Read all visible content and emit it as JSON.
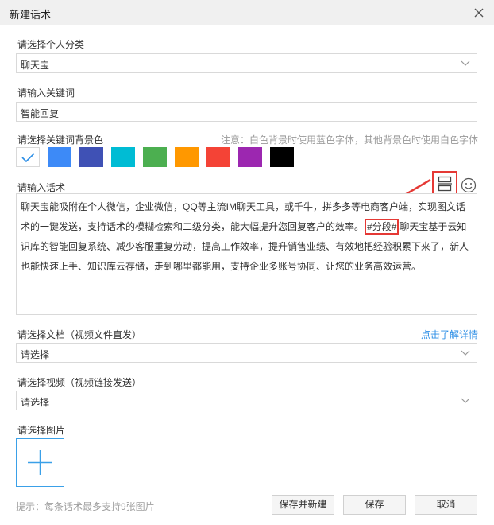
{
  "window": {
    "title": "新建话术"
  },
  "category": {
    "label": "请选择个人分类",
    "value": "聊天宝"
  },
  "keyword": {
    "label": "请输入关键词",
    "value": "智能回复"
  },
  "bg_color": {
    "label": "请选择关键词背景色",
    "note": "注意：白色背景时使用蓝色字体，其他背景色时使用白色字体",
    "colors": [
      "#ffffff",
      "#3d8af7",
      "#3f51b5",
      "#00bcd4",
      "#4caf50",
      "#ff9800",
      "#f44336",
      "#9c27b0",
      "#000000"
    ],
    "selected": 0
  },
  "script": {
    "label": "请输入话术",
    "text_before": "聊天宝能吸附在个人微信，企业微信，QQ等主流IM聊天工具，或千牛，拼多多等电商客户端，实现图文话术的一键发送，支持话术的模糊检索和二级分类，能大幅提升您回复客户的效率。",
    "segment_tag": "#分段#",
    "text_after": "聊天宝基于云知识库的智能回复系统、减少客服重复劳动，提高工作效率，提升销售业绩、有效地把经验积累下来了，新人也能快速上手、知识库云存储，走到哪里都能用，支持企业多账号协同、让您的业务高效运营。"
  },
  "document": {
    "label": "请选择文档（视频文件直发）",
    "link": "点击了解详情",
    "value": "请选择"
  },
  "video": {
    "label": "请选择视频（视频链接发送）",
    "value": "请选择"
  },
  "image": {
    "label": "请选择图片"
  },
  "footer": {
    "hint": "提示：每条话术最多支持9张图片",
    "save_new": "保存并新建",
    "save": "保存",
    "cancel": "取消"
  },
  "accent_color": "#2b8ee6",
  "highlight_color": "#e53935"
}
